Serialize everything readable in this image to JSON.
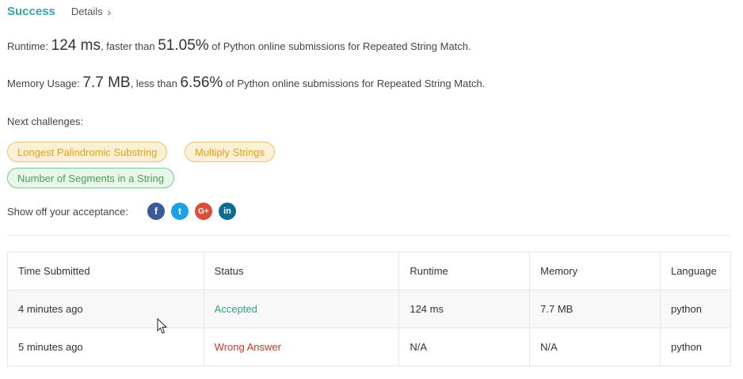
{
  "header": {
    "status": "Success",
    "details_label": "Details",
    "details_chevron": "›"
  },
  "runtime": {
    "prefix": "Runtime: ",
    "value": "124 ms",
    "mid": ", faster than ",
    "percent": "51.05%",
    "suffix": " of Python online submissions for Repeated String Match."
  },
  "memory": {
    "prefix": "Memory Usage: ",
    "value": "7.7 MB",
    "mid": ", less than ",
    "percent": "6.56%",
    "suffix": " of Python online submissions for Repeated String Match."
  },
  "next": {
    "label": "Next challenges:",
    "items": [
      {
        "label": "Longest Palindromic Substring",
        "difficulty_color": "#e6a017"
      },
      {
        "label": "Multiply Strings",
        "difficulty_color": "#e6a017"
      },
      {
        "label": "Number of Segments in a String",
        "difficulty_color": "#4a9e55"
      }
    ]
  },
  "share": {
    "label": "Show off your acceptance:",
    "icons": [
      "facebook-icon",
      "twitter-icon",
      "google-plus-icon",
      "linkedin-icon"
    ],
    "glyphs": {
      "facebook": "f",
      "twitter": "t",
      "google": "G+",
      "linkedin": "in"
    }
  },
  "table": {
    "headers": [
      "Time Submitted",
      "Status",
      "Runtime",
      "Memory",
      "Language"
    ],
    "rows": [
      {
        "time": "4 minutes ago",
        "status": "Accepted",
        "runtime": "124 ms",
        "memory": "7.7 MB",
        "language": "python"
      },
      {
        "time": "5 minutes ago",
        "status": "Wrong Answer",
        "runtime": "N/A",
        "memory": "N/A",
        "language": "python"
      }
    ]
  },
  "colors": {
    "success": "#3aa5a5",
    "accepted": "#2f9d8f",
    "wrong_answer": "#c0392b"
  }
}
